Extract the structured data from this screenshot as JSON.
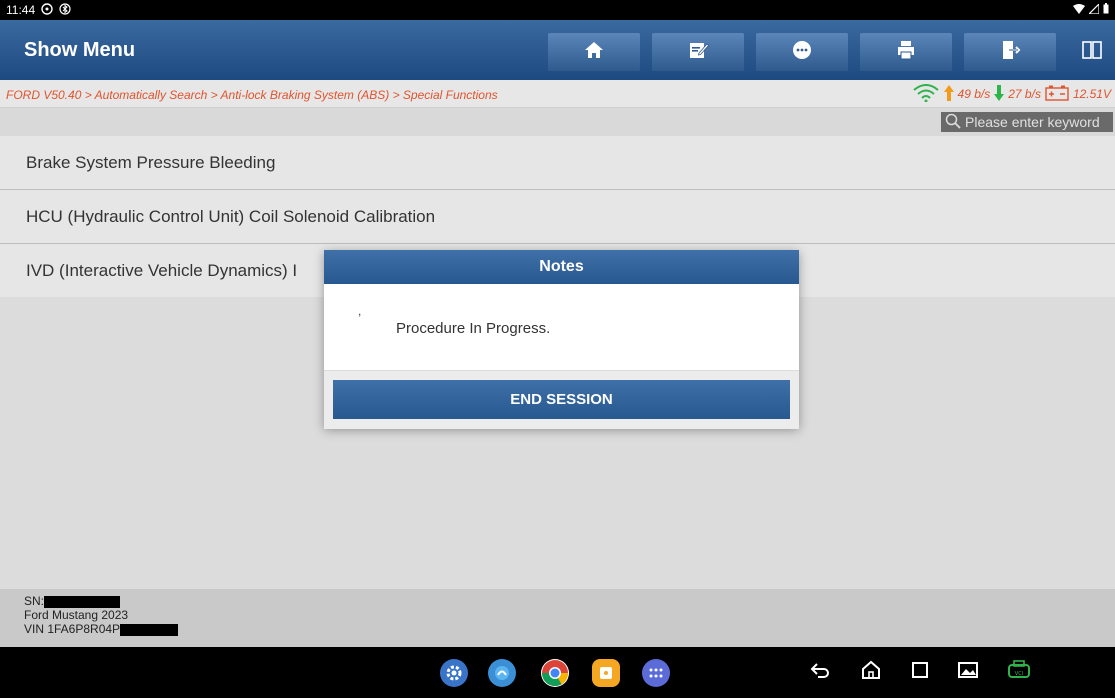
{
  "status_bar": {
    "time": "11:44"
  },
  "header": {
    "title": "Show Menu",
    "tools": [
      "home",
      "edit",
      "chat",
      "print",
      "exit",
      "split"
    ]
  },
  "breadcrumb": "FORD V50.40 > Automatically Search > Anti-lock Braking System (ABS) > Special Functions",
  "metrics": {
    "up": "49 b/s",
    "down": "27 b/s",
    "voltage": "12.51V"
  },
  "search": {
    "placeholder": "Please enter keyword"
  },
  "menu_items": [
    "Brake System Pressure Bleeding",
    "HCU (Hydraulic Control Unit) Coil Solenoid Calibration",
    "IVD (Interactive Vehicle Dynamics) I"
  ],
  "footer": {
    "sn_label": "SN:",
    "vehicle": "Ford Mustang 2023",
    "vin_label": "VIN 1FA6P8R04P"
  },
  "dialog": {
    "title": "Notes",
    "tick": ",",
    "message": "Procedure In Progress.",
    "button": "END SESSION"
  },
  "colors": {
    "header": "#275890",
    "breadcrumb": "#e0542e",
    "accent_green": "#2fb34b"
  }
}
